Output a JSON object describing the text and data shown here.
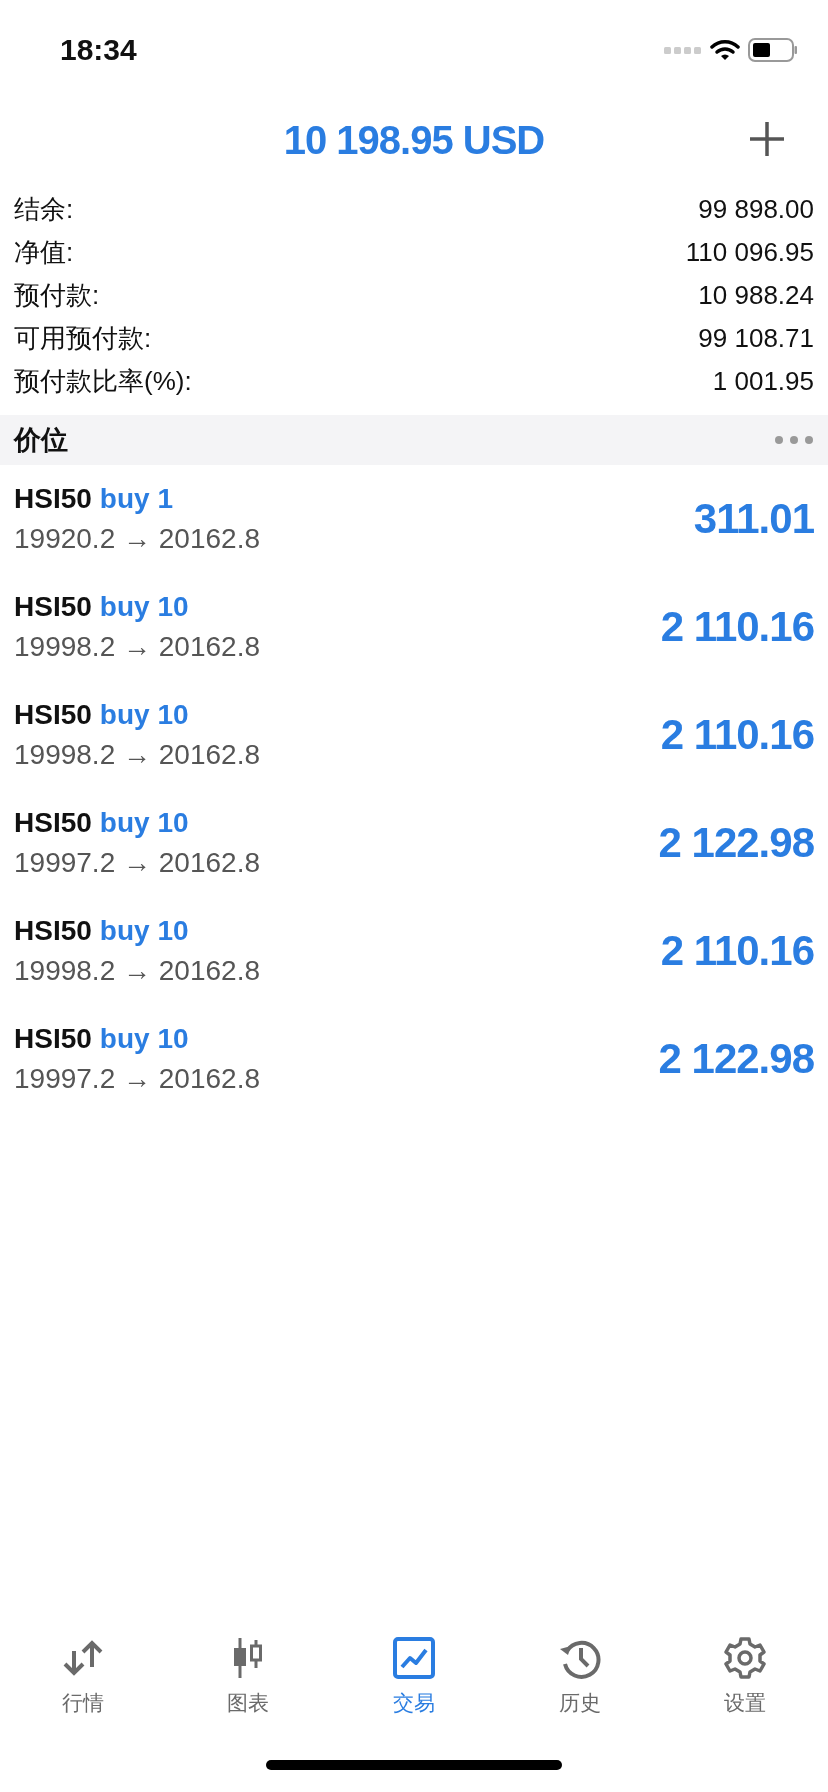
{
  "status_bar": {
    "time": "18:34"
  },
  "header": {
    "title": "10 198.95 USD"
  },
  "summary": [
    {
      "label": "结余:",
      "value": "99 898.00"
    },
    {
      "label": "净值:",
      "value": "110 096.95"
    },
    {
      "label": "预付款:",
      "value": "10 988.24"
    },
    {
      "label": "可用预付款:",
      "value": "99 108.71"
    },
    {
      "label": "预付款比率(%):",
      "value": "1 001.95"
    }
  ],
  "positions_section": {
    "title": "价位"
  },
  "positions": [
    {
      "symbol": "HSI50",
      "side": "buy 1",
      "prices": "19920.2 → 20162.8",
      "profit": "311.01"
    },
    {
      "symbol": "HSI50",
      "side": "buy 10",
      "prices": "19998.2 → 20162.8",
      "profit": "2 110.16"
    },
    {
      "symbol": "HSI50",
      "side": "buy 10",
      "prices": "19998.2 → 20162.8",
      "profit": "2 110.16"
    },
    {
      "symbol": "HSI50",
      "side": "buy 10",
      "prices": "19997.2 → 20162.8",
      "profit": "2 122.98"
    },
    {
      "symbol": "HSI50",
      "side": "buy 10",
      "prices": "19998.2 → 20162.8",
      "profit": "2 110.16"
    },
    {
      "symbol": "HSI50",
      "side": "buy 10",
      "prices": "19997.2 → 20162.8",
      "profit": "2 122.98"
    }
  ],
  "tab_bar": [
    {
      "kind": "quotes",
      "label": "行情",
      "selected": false
    },
    {
      "kind": "chart",
      "label": "图表",
      "selected": false
    },
    {
      "kind": "trade",
      "label": "交易",
      "selected": true
    },
    {
      "kind": "history",
      "label": "历史",
      "selected": false
    },
    {
      "kind": "settings",
      "label": "设置",
      "selected": false
    }
  ]
}
